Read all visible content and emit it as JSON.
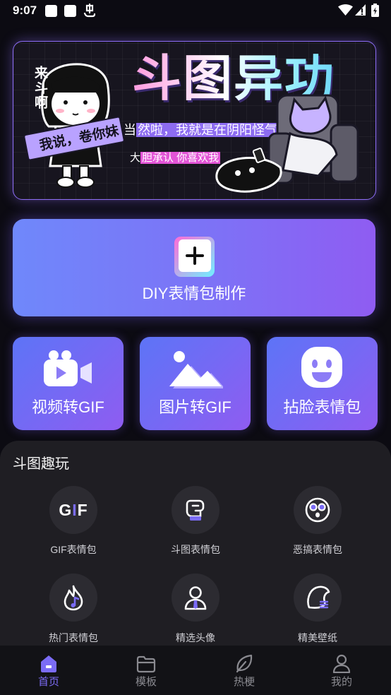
{
  "status_bar": {
    "time": "9:07",
    "left_icons": [
      "square-notification-icon",
      "square-notification-icon",
      "app-notification-icon"
    ],
    "right_icons": [
      "wifi-icon",
      "signal-icon",
      "battery-icon"
    ]
  },
  "banner": {
    "title": "斗图异功",
    "side_text": "来斗啊",
    "ribbon_text": "我说，卷你妹",
    "line1_lead": "当",
    "line1_highlight": "然啦，我就是在阴阳怪气",
    "line2_lead": "大",
    "line2_highlight": "胆承认 你喜欢我"
  },
  "diy": {
    "label": "DIY表情包制作",
    "icon": "plus-icon"
  },
  "tools": [
    {
      "label": "视频转GIF",
      "icon": "video-camera-icon"
    },
    {
      "label": "图片转GIF",
      "icon": "image-icon"
    },
    {
      "label": "拈脸表情包",
      "icon": "smiley-icon"
    }
  ],
  "fun": {
    "title": "斗图趣玩",
    "items": [
      {
        "label": "GIF表情包",
        "icon": "gif-icon",
        "icon_text_parts": [
          "G",
          "I",
          "F"
        ]
      },
      {
        "label": "斗图表情包",
        "icon": "fist-icon"
      },
      {
        "label": "恶搞表情包",
        "icon": "funny-face-icon"
      },
      {
        "label": "热门表情包",
        "icon": "flame-icon"
      },
      {
        "label": "精选头像",
        "icon": "avatar-icon"
      },
      {
        "label": "精美壁纸",
        "icon": "wallpaper-icon"
      }
    ]
  },
  "nav": {
    "items": [
      {
        "label": "首页",
        "icon": "home-icon",
        "active": true
      },
      {
        "label": "模板",
        "icon": "folder-icon",
        "active": false
      },
      {
        "label": "热梗",
        "icon": "leaf-icon",
        "active": false
      },
      {
        "label": "我的",
        "icon": "profile-icon",
        "active": false
      }
    ]
  },
  "colors": {
    "background": "#0c0b12",
    "accent": "#7b6cf6",
    "banner_border": "#8c6cf5",
    "card_gradient_start": "#5d74f7",
    "card_gradient_end": "#8f5cf1",
    "sheet_background": "#1f1e23",
    "nav_inactive": "#8a8a90"
  }
}
